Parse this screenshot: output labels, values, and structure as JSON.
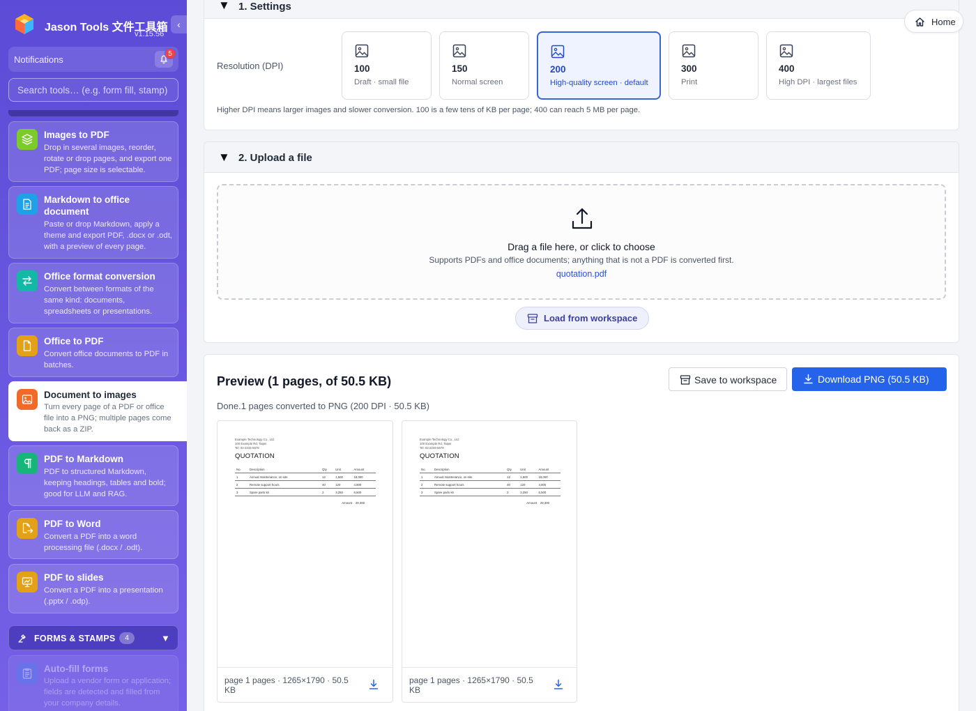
{
  "app": {
    "title": "Jason Tools 文件工具箱",
    "version": "v1.15.56",
    "collapse_glyph": "‹"
  },
  "notifications": {
    "label": "Notifications",
    "count": "5"
  },
  "search": {
    "placeholder": "Search tools… (e.g. form fill, stamp)"
  },
  "tools": [
    {
      "name": "Images to PDF",
      "desc": "Drop in several images, reorder, rotate or drop pages, and export one PDF; page size is selectable.",
      "icon": "layers-icon",
      "color": "#7ccb2a"
    },
    {
      "name": "Markdown to office document",
      "desc": "Paste or drop Markdown, apply a theme and export PDF, .docx or .odt, with a preview of every page.",
      "icon": "document-icon",
      "color": "#1ea1e8"
    },
    {
      "name": "Office format conversion",
      "desc": "Convert between formats of the same kind: documents, spreadsheets or presentations.",
      "icon": "swap-arrows-icon",
      "color": "#14b8a6"
    },
    {
      "name": "Office to PDF",
      "desc": "Convert office documents to PDF in batches.",
      "icon": "file-icon",
      "color": "#e2a116"
    },
    {
      "name": "Document to images",
      "desc": "Turn every page of a PDF or office file into a PNG; multiple pages come back as a ZIP.",
      "icon": "image-icon",
      "color": "#f06a2a"
    },
    {
      "name": "PDF to Markdown",
      "desc": "PDF to structured Markdown, keeping headings, tables and bold; good for LLM and RAG.",
      "icon": "pilcrow-icon",
      "color": "#18b57a"
    },
    {
      "name": "PDF to Word",
      "desc": "Convert a PDF into a word processing file (.docx / .odt).",
      "icon": "file-export-icon",
      "color": "#e2a116"
    },
    {
      "name": "PDF to slides",
      "desc": "Convert a PDF into a presentation (.pptx / .odp).",
      "icon": "presentation-icon",
      "color": "#e2a116"
    },
    {
      "name": "Auto-fill forms",
      "desc": "Upload a vendor form or application; fields are detected and filled from your company details.",
      "icon": "clipboard-icon",
      "color": "#5b8def"
    }
  ],
  "section": {
    "label": "FORMS & STAMPS",
    "count": "4",
    "caret": "▼"
  },
  "settings": {
    "caret": "▼",
    "title": "1. Settings",
    "resolution_label": "Resolution (DPI)",
    "options": [
      {
        "value": "100",
        "desc": "Draft · small file"
      },
      {
        "value": "150",
        "desc": "Normal screen"
      },
      {
        "value": "200",
        "desc": "High-quality screen · default"
      },
      {
        "value": "300",
        "desc": "Print"
      },
      {
        "value": "400",
        "desc": "High DPI · largest files"
      }
    ],
    "selected": "200",
    "hint": "Higher DPI means larger images and slower conversion. 100 is a few tens of KB per page; 400 can reach 5 MB per page."
  },
  "upload": {
    "caret": "▼",
    "title": "2. Upload a file",
    "drop_main": "Drag a file here, or click to choose",
    "drop_sub": "Supports PDFs and office documents; anything that is not a PDF is converted first.",
    "file_name": "quotation.pdf",
    "workspace_button": "Load from workspace"
  },
  "preview": {
    "title": "Preview (1 pages, of 50.5 KB)",
    "save_button": "Save to workspace",
    "download_button": "Download PNG (50.5 KB)",
    "status": "Done.1 pages converted to PNG (200 DPI · 50.5 KB)",
    "thumbs": [
      {
        "meta": "page 1 pages · 1265×1790 · 50.5 KB"
      },
      {
        "meta": "page 1 pages · 1265×1790 · 50.5 KB"
      }
    ],
    "doc": {
      "company": [
        "Example Technology Co., Ltd.",
        "100 Example Rd, Taipei",
        "Tel: 02-2234-5678"
      ],
      "title": "QUOTATION",
      "headers": [
        "No.",
        "Description",
        "Qty",
        "Unit",
        "Amount"
      ],
      "rows": [
        [
          "1",
          "Annual maintenance, on-site",
          "12",
          "1,500",
          "18,000"
        ],
        [
          "2",
          "Remote support hours",
          "40",
          "120",
          "4,800"
        ],
        [
          "3",
          "Spare parts kit",
          "2",
          "3,250",
          "6,500"
        ]
      ],
      "amount_label": "Amount",
      "amount_value": "29,300"
    }
  },
  "home": {
    "label": "Home"
  },
  "colors": {
    "accent": "#2563eb",
    "sidebar": "#6a58e0",
    "selected_border": "#3b63d9"
  }
}
